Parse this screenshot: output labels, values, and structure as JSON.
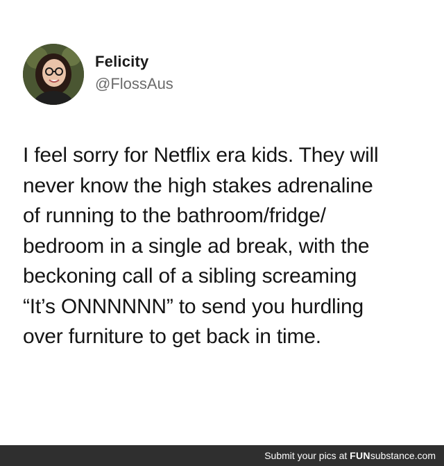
{
  "tweet": {
    "author_name": "Felicity",
    "author_handle": "@FlossAus",
    "lines": [
      "I feel sorry for Netflix era kids. They will",
      "never know the high stakes adrenaline",
      "of running to the bathroom/fridge/",
      "bedroom in a single ad break, with the",
      "beckoning call of a sibling screaming",
      "“It’s ONNNNNN” to send you hurdling",
      "over furniture to get back in time."
    ]
  },
  "footer": {
    "prefix": "Submit your pics at ",
    "brand_bold": "FUN",
    "brand_light": "substance",
    "suffix": ".com"
  },
  "colors": {
    "footer_bg": "#2f2f2f",
    "handle": "#6b6b6b"
  }
}
